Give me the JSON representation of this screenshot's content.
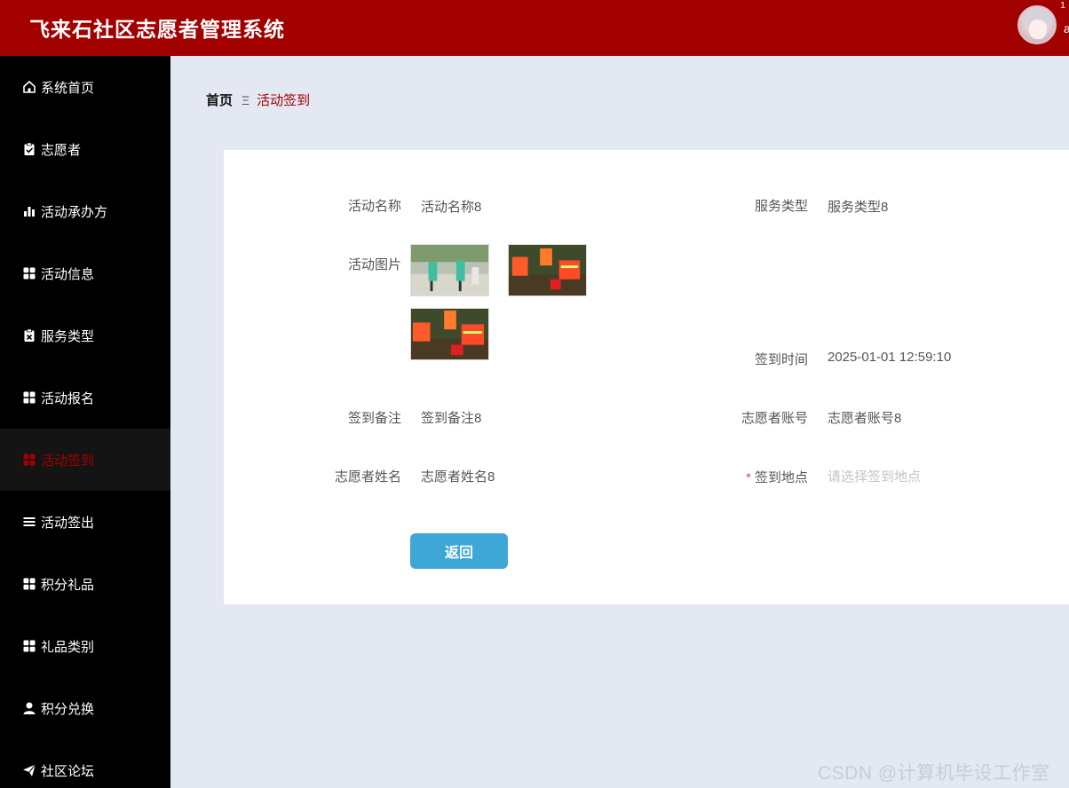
{
  "app": {
    "title": "飞来石社区志愿者管理系统",
    "user_initial": "a",
    "badge": "1"
  },
  "sidebar": {
    "items": [
      {
        "label": "系统首页",
        "icon": "home-icon"
      },
      {
        "label": "志愿者",
        "icon": "clipboard-check-icon"
      },
      {
        "label": "活动承办方",
        "icon": "bar-chart-icon"
      },
      {
        "label": "活动信息",
        "icon": "grid-icon"
      },
      {
        "label": "服务类型",
        "icon": "clipboard-x-icon"
      },
      {
        "label": "活动报名",
        "icon": "grid-icon"
      },
      {
        "label": "活动签到",
        "icon": "grid-icon",
        "active": true
      },
      {
        "label": "活动签出",
        "icon": "list-icon"
      },
      {
        "label": "积分礼品",
        "icon": "grid-icon"
      },
      {
        "label": "礼品类别",
        "icon": "grid-icon"
      },
      {
        "label": "积分兑换",
        "icon": "user-icon"
      },
      {
        "label": "社区论坛",
        "icon": "send-icon"
      }
    ]
  },
  "breadcrumb": {
    "home": "首页",
    "separator": "Ξ",
    "current": "活动签到"
  },
  "form": {
    "activity_name": {
      "label": "活动名称",
      "value": "活动名称8"
    },
    "service_type": {
      "label": "服务类型",
      "value": "服务类型8"
    },
    "activity_images": {
      "label": "活动图片"
    },
    "checkin_time": {
      "label": "签到时间",
      "value": "2025-01-01 12:59:10"
    },
    "checkin_note": {
      "label": "签到备注",
      "value": "签到备注8"
    },
    "volunteer_account": {
      "label": "志愿者账号",
      "value": "志愿者账号8"
    },
    "volunteer_name": {
      "label": "志愿者姓名",
      "value": "志愿者姓名8"
    },
    "checkin_location": {
      "label": "签到地点",
      "required_mark": "*",
      "placeholder": "请选择签到地点"
    },
    "back_button": "返回"
  },
  "watermark": "CSDN @计算机毕设工作室",
  "colors": {
    "header": "#a30000",
    "sidebar": "#000000",
    "accent": "#a30000",
    "button": "#3ea7d5",
    "background": "#e3e8f3"
  }
}
